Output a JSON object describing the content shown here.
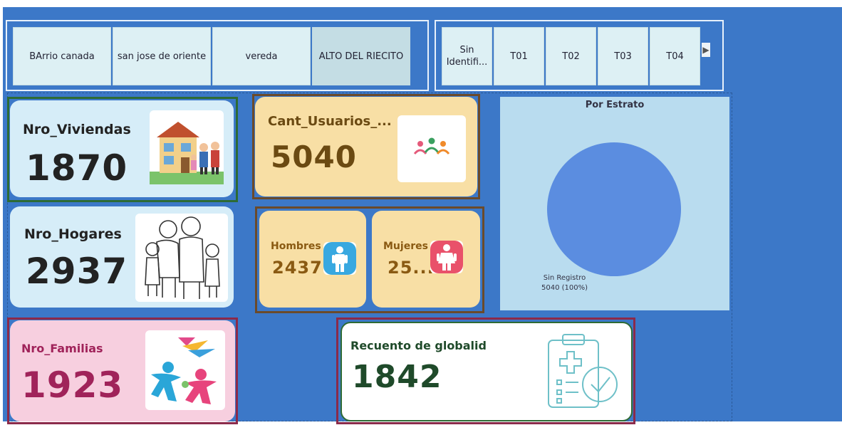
{
  "slicers": {
    "location": [
      "BArrio canada",
      "san jose de oriente",
      "vereda",
      "ALTO DEL RIECITO"
    ],
    "estrato": [
      "Sin Identifi...",
      "T01",
      "T02",
      "T03",
      "T04"
    ]
  },
  "cards": {
    "viviendas": {
      "label": "Nro_Viviendas",
      "value": "1870"
    },
    "hogares": {
      "label": "Nro_Hogares",
      "value": "2937"
    },
    "familias": {
      "label": "Nro_Familias",
      "value": "1923"
    },
    "usuarios": {
      "label": "Cant_Usuarios_...",
      "value": "5040"
    },
    "hombres": {
      "label": "Hombres",
      "value": "2437"
    },
    "mujeres": {
      "label": "Mujeres",
      "value": "25..."
    },
    "recuento": {
      "label": "Recuento de globalid",
      "value": "1842"
    }
  },
  "colors": {
    "background": "#3c78c8",
    "viviendas_text": "#222222",
    "familias_text": "#a0235a",
    "usuarios_text": "#6b4a12",
    "genders_text": "#8a5a12",
    "recuento_text": "#1f4a2a",
    "pie_fill": "#5b8de0"
  },
  "icons": {
    "viviendas": "house-family-icon",
    "hogares": "family-sketch-icon",
    "familias": "family-logo-icon",
    "usuarios": "users-group-icon",
    "hombres": "male-icon",
    "mujeres": "female-icon",
    "recuento": "clipboard-check-icon"
  },
  "chart_data": {
    "type": "pie",
    "title": "Por Estrato",
    "slices": [
      {
        "label": "Sin Registro",
        "value": 5040,
        "percent": 100
      }
    ],
    "label_text": [
      "Sin Registro",
      "5040 (100%)"
    ]
  }
}
